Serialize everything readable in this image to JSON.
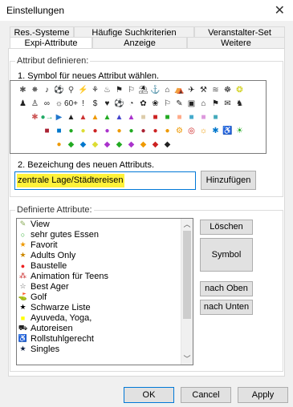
{
  "window": {
    "title": "Einstellungen",
    "close_glyph": "✕"
  },
  "tabs_back": [
    "Res.-Systeme",
    "Häufige Suchkriterien",
    "Veranstalter-Set"
  ],
  "tabs_front": [
    "Expi-Attribute",
    "Anzeige",
    "Weitere"
  ],
  "define_group": {
    "label": "Attribut definieren:",
    "step1": "1. Symbol für neues Attribut wählen.",
    "step2": "2. Bezeichung des neuen Attributs.",
    "name_value": "zentrale Lage/Städtereisen",
    "add_button": "Hinzufügen"
  },
  "symbols": [
    "✱",
    "✸",
    "♪",
    "⚽",
    "⚲",
    "⚡",
    "⚘",
    "♨",
    "⚑",
    "⚐",
    "⛱",
    "⚓",
    "⌂",
    "⛺",
    "✈",
    "⚒",
    "≋",
    "☸",
    "❂",
    "♟",
    "♙",
    "∞",
    "☼",
    "60+",
    "!",
    "$",
    "♥",
    "⚽",
    "◔",
    "✿",
    "❀",
    "⚐",
    "✎",
    "▣",
    "⌂",
    "⚑",
    "✉",
    "♞",
    "",
    "✱",
    "●→",
    "▶",
    "▲",
    "▲",
    "▲",
    "▲",
    "▲",
    "▲",
    "■",
    "■",
    "■",
    "■",
    "■",
    "■",
    "■",
    "",
    "",
    "",
    "",
    "■",
    "■",
    "●",
    "●",
    "●",
    "●",
    "●",
    "●",
    "●",
    "●",
    "●",
    "⚙",
    "◎",
    "☼",
    "✱",
    "♿",
    "☀",
    "✲",
    "",
    "",
    "●",
    "◆",
    "◆",
    "◆",
    "◆",
    "◆",
    "◆",
    "◆",
    "◆",
    "◆",
    "◆",
    "⛟",
    "",
    "",
    "",
    "",
    "",
    "",
    ""
  ],
  "symbol_colors": [
    "#555",
    "#666",
    "#222",
    "#333",
    "#444",
    "#444",
    "#333",
    "#444",
    "#222",
    "#222",
    "#222",
    "#222",
    "#222",
    "#222",
    "#222",
    "#222",
    "#555",
    "#222",
    "#cc0",
    "#222",
    "#222",
    "#222",
    "#222",
    "#222",
    "#222",
    "#222",
    "#222",
    "#222",
    "#222",
    "#222",
    "#222",
    "#222",
    "#222",
    "#222",
    "#222",
    "#222",
    "#222",
    "#222",
    "#fff",
    "#c55",
    "#2a6",
    "#27c",
    "#222",
    "#c33",
    "#e90",
    "#2a2",
    "#44c",
    "#a3c",
    "#dca",
    "#c22",
    "#2a2",
    "#fa8",
    "#4ac",
    "#d9d",
    "#4ab",
    "#fff",
    "#fff",
    "#fff",
    "#c22",
    "#a23",
    "#07c",
    "#2a2",
    "#dd3",
    "#c22",
    "#a3c",
    "#e90",
    "#2a2",
    "#a23",
    "#c22",
    "#e90",
    "#e90",
    "#c22",
    "#e90",
    "#07c",
    "#e90",
    "#2a2",
    "#fff",
    "#27c",
    "#c22",
    "#e90",
    "#2a2",
    "#07c",
    "#dd3",
    "#a3c",
    "#2a2",
    "#a3c",
    "#e90",
    "#c22",
    "#222",
    "#fff",
    "#fff",
    "#fff",
    "#fff",
    "#fff",
    "#fff",
    "#fff"
  ],
  "defined_group": {
    "label": "Definierte Attribute:"
  },
  "attributes": [
    {
      "label": "View",
      "icon": "✎",
      "color": "#8a5"
    },
    {
      "label": "sehr gutes Essen",
      "icon": "○",
      "color": "#2a2"
    },
    {
      "label": "Favorit",
      "icon": "★",
      "color": "#e90"
    },
    {
      "label": "Adults Only",
      "icon": "★",
      "color": "#c80"
    },
    {
      "label": "Baustelle",
      "icon": "●",
      "color": "#e22"
    },
    {
      "label": "Animation für Teens",
      "icon": "⁂",
      "color": "#c33"
    },
    {
      "label": "Best Ager",
      "icon": "☆",
      "color": "#555"
    },
    {
      "label": "Golf",
      "icon": "⛳",
      "color": "#222"
    },
    {
      "label": "Schwarze Liste",
      "icon": "★",
      "color": "#000"
    },
    {
      "label": "Ayuveda, Yoga,",
      "icon": "■",
      "color": "#ff0"
    },
    {
      "label": "Autoreisen",
      "icon": "⛟",
      "color": "#222"
    },
    {
      "label": "Rollstuhlgerecht",
      "icon": "♿",
      "color": "#222"
    },
    {
      "label": "Singles",
      "icon": "★",
      "color": "#124"
    }
  ],
  "side_buttons": {
    "delete": "Löschen",
    "change_symbol": "Symbol ändern",
    "up": "nach Oben",
    "down": "nach Unten"
  },
  "footer": {
    "ok": "OK",
    "cancel": "Cancel",
    "apply": "Apply"
  },
  "colors": {
    "highlight": "#fff23a",
    "focus_border": "#0078d7"
  }
}
